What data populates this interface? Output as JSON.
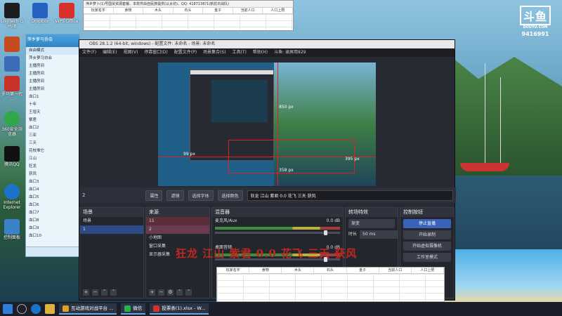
{
  "desktop": {
    "icons": [
      {
        "label": "Logitech G HUB",
        "color": "#1d1d1d"
      },
      {
        "label": "Dropbox",
        "color": "#2561c1"
      },
      {
        "label": "WPS Office",
        "color": "#d9302b"
      },
      {
        "label": "",
        "color": "#c64b1e"
      },
      {
        "label": "",
        "color": "#3c6bb8"
      },
      {
        "label": "罗马第一代 ...",
        "color": "#c8322b"
      },
      {
        "label": "360安全浏览器",
        "color": "#2ea84a"
      },
      {
        "label": "腾讯QQ",
        "color": "#111111"
      },
      {
        "label": "Internet Explorer",
        "color": "#1b72c8"
      },
      {
        "label": "控制面板",
        "color": "#3c82c7"
      }
    ],
    "watermark": {
      "logo": "斗鱼",
      "sub": "DOUYU.COM",
      "room": "9416991"
    }
  },
  "sheet_top": {
    "title": "萍乡萝卜(1)号国贸资源套餐、本软件由自民族提供(以太坊)、QQ: 4187138?1(新抗日战队)",
    "columns": [
      "玩家名字",
      "食物",
      "木头",
      "石头",
      "金子",
      "当前人口",
      "人口上限"
    ]
  },
  "qq": {
    "top": "萍乡萝马协会",
    "mode": "自由模式",
    "rows": [
      "萍乡萝马协会",
      "主播房间",
      "主播房间",
      "主播房间",
      "主播房间",
      "血口1",
      "十年",
      "王增天",
      "紫君",
      "血口2",
      "三亚",
      "三天",
      "花枝堆它",
      "江山",
      "狂龙",
      "获凤",
      "血口3",
      "血口4",
      "血口5",
      "血口6",
      "血口7",
      "血口8",
      "血口9",
      "血口10"
    ]
  },
  "obs": {
    "title": "OBS 28.1.2 (64-bit, windows) - 配置文件: 未命名 - 场景: 未命名",
    "menu": [
      "文件(F)",
      "编辑(E)",
      "视图(V)",
      "停靠窗口(D)",
      "配置文件(P)",
      "场景集合(S)",
      "工具(T)",
      "帮助(H)",
      "斗鱼: 录屏用829"
    ],
    "preview_labels": [
      "850 px",
      "395 px",
      "99 px",
      "358 px"
    ],
    "source_count": "2",
    "toolbar": [
      "属性",
      "滤镜",
      "选择字体",
      "选择颜色"
    ],
    "text_value": "狂龙 江山 紫君 0.0 花飞 三天 获风",
    "scenes": {
      "header": "场景",
      "items": [
        "场景",
        "1"
      ]
    },
    "sources": {
      "header": "来源",
      "items": [
        "11",
        "2",
        "小地图",
        "窗口采集",
        "显示器采集"
      ]
    },
    "mixer": {
      "header": "混音器",
      "channels": [
        {
          "name": "麦克风/Aux",
          "db": "0.0 dB"
        },
        {
          "name": "桌面音频",
          "db": "0.0 dB"
        }
      ]
    },
    "transitions": {
      "header": "转场特效",
      "type": "渐变",
      "duration_label": "时长",
      "duration": "50 ms"
    },
    "controls": {
      "header": "控制按钮",
      "buttons": [
        "停止直播",
        "开始录制",
        "开始虚拟摄像机",
        "工作室模式"
      ]
    }
  },
  "overlay_text": "狂龙 江山 紫君 0.0 花飞 三天 获风",
  "sheet_bottom": {
    "columns": [
      "玩家名字",
      "食物",
      "木头",
      "石头",
      "金子",
      "当前人口",
      "人口上限"
    ]
  },
  "taskbar": {
    "apps": [
      {
        "label": "互动游戏对战平台 ...",
        "color": "#e0a020"
      },
      {
        "label": "微信",
        "color": "#2bb24c"
      },
      {
        "label": "投票表(1).xlsx - W...",
        "color": "#d9302b"
      }
    ]
  }
}
